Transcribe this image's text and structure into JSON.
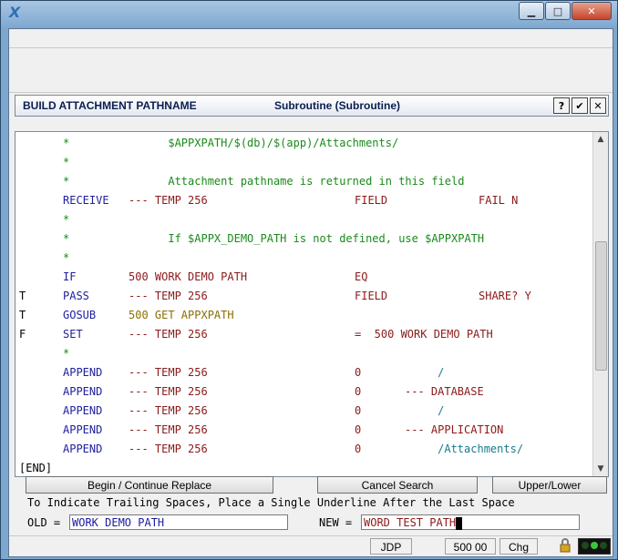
{
  "window": {
    "app_icon": "x-app-logo-icon",
    "controls": {
      "minimize": "▁",
      "maximize": "□",
      "close": "✕"
    }
  },
  "dialog": {
    "title": "BUILD ATTACHMENT PATHNAME",
    "subtitle": "Subroutine  (Subroutine)",
    "help": "?",
    "ok": "✔",
    "close": "✕"
  },
  "editor": {
    "lines": [
      {
        "flag": "",
        "kw": "*",
        "f1": "      $APPXPATH/$(db)/$(app)/Attachments/",
        "f2": "",
        "f3": "",
        "fx": ""
      },
      {
        "flag": "",
        "kw": "*",
        "f1": "",
        "f2": "",
        "f3": "",
        "fx": ""
      },
      {
        "flag": "",
        "kw": "*",
        "f1": "      Attachment pathname is returned in this field",
        "f2": "",
        "f3": "",
        "fx": ""
      },
      {
        "flag": "",
        "kw": "RECEIVE",
        "f1": "--- TEMP 256",
        "f2": "FIELD",
        "f3": "",
        "fx": "FAIL N"
      },
      {
        "flag": "",
        "kw": "*",
        "f1": "",
        "f2": "",
        "f3": "",
        "fx": ""
      },
      {
        "flag": "",
        "kw": "*",
        "f1": "      If $APPX_DEMO_PATH is not defined, use $APPXPATH",
        "f2": "",
        "f3": "",
        "fx": ""
      },
      {
        "flag": "",
        "kw": "*",
        "f1": "",
        "f2": "",
        "f3": "",
        "fx": ""
      },
      {
        "flag": "",
        "kw": "IF",
        "f1": "500 WORK DEMO PATH",
        "f2": "EQ",
        "f3": "",
        "fx": ""
      },
      {
        "flag": "T",
        "kw": "PASS",
        "f1": "--- TEMP 256",
        "f2": "FIELD",
        "f3": "",
        "fx": "SHARE? Y"
      },
      {
        "flag": "T",
        "kw": "GOSUB",
        "f1": "500 GET APPXPATH",
        "f2": "",
        "f3": "",
        "fx": ""
      },
      {
        "flag": "F",
        "kw": "SET",
        "f1": "--- TEMP 256",
        "f2": "=  500 WORK DEMO PATH",
        "f3": "",
        "fx": ""
      },
      {
        "flag": "",
        "kw": "*",
        "f1": "",
        "f2": "",
        "f3": "",
        "fx": ""
      },
      {
        "flag": "",
        "kw": "APPEND",
        "f1": "--- TEMP 256",
        "f2": "0",
        "f3": "     /",
        "fx": ""
      },
      {
        "flag": "",
        "kw": "APPEND",
        "f1": "--- TEMP 256",
        "f2": "0",
        "f3": "--- DATABASE",
        "fx": ""
      },
      {
        "flag": "",
        "kw": "APPEND",
        "f1": "--- TEMP 256",
        "f2": "0",
        "f3": "     /",
        "fx": ""
      },
      {
        "flag": "",
        "kw": "APPEND",
        "f1": "--- TEMP 256",
        "f2": "0",
        "f3": "--- APPLICATION",
        "fx": ""
      },
      {
        "flag": "",
        "kw": "APPEND",
        "f1": "--- TEMP 256",
        "f2": "0",
        "f3": "     /Attachments/",
        "fx": ""
      },
      {
        "flag": "[END]",
        "kw": "",
        "f1": "",
        "f2": "",
        "f3": "",
        "fx": ""
      }
    ]
  },
  "buttons": {
    "begin": "Begin / Continue Replace",
    "cancel": "Cancel Search",
    "upper": "Upper/Lower"
  },
  "replace": {
    "hint": "To Indicate Trailing Spaces, Place a Single Underline After the Last Space",
    "old_label": "OLD =",
    "old_value": "WORK DEMO PATH",
    "new_label": "NEW =",
    "new_value": "WORD TEST PATH"
  },
  "status": {
    "user": "JDP",
    "process": "500 00",
    "mode": "Chg"
  },
  "colors": {
    "keyword": "#2020a0",
    "comment": "#1a8a1a",
    "field": "#8b1a1a",
    "gosub": "#8a7000",
    "literal": "#1a7a8a"
  }
}
